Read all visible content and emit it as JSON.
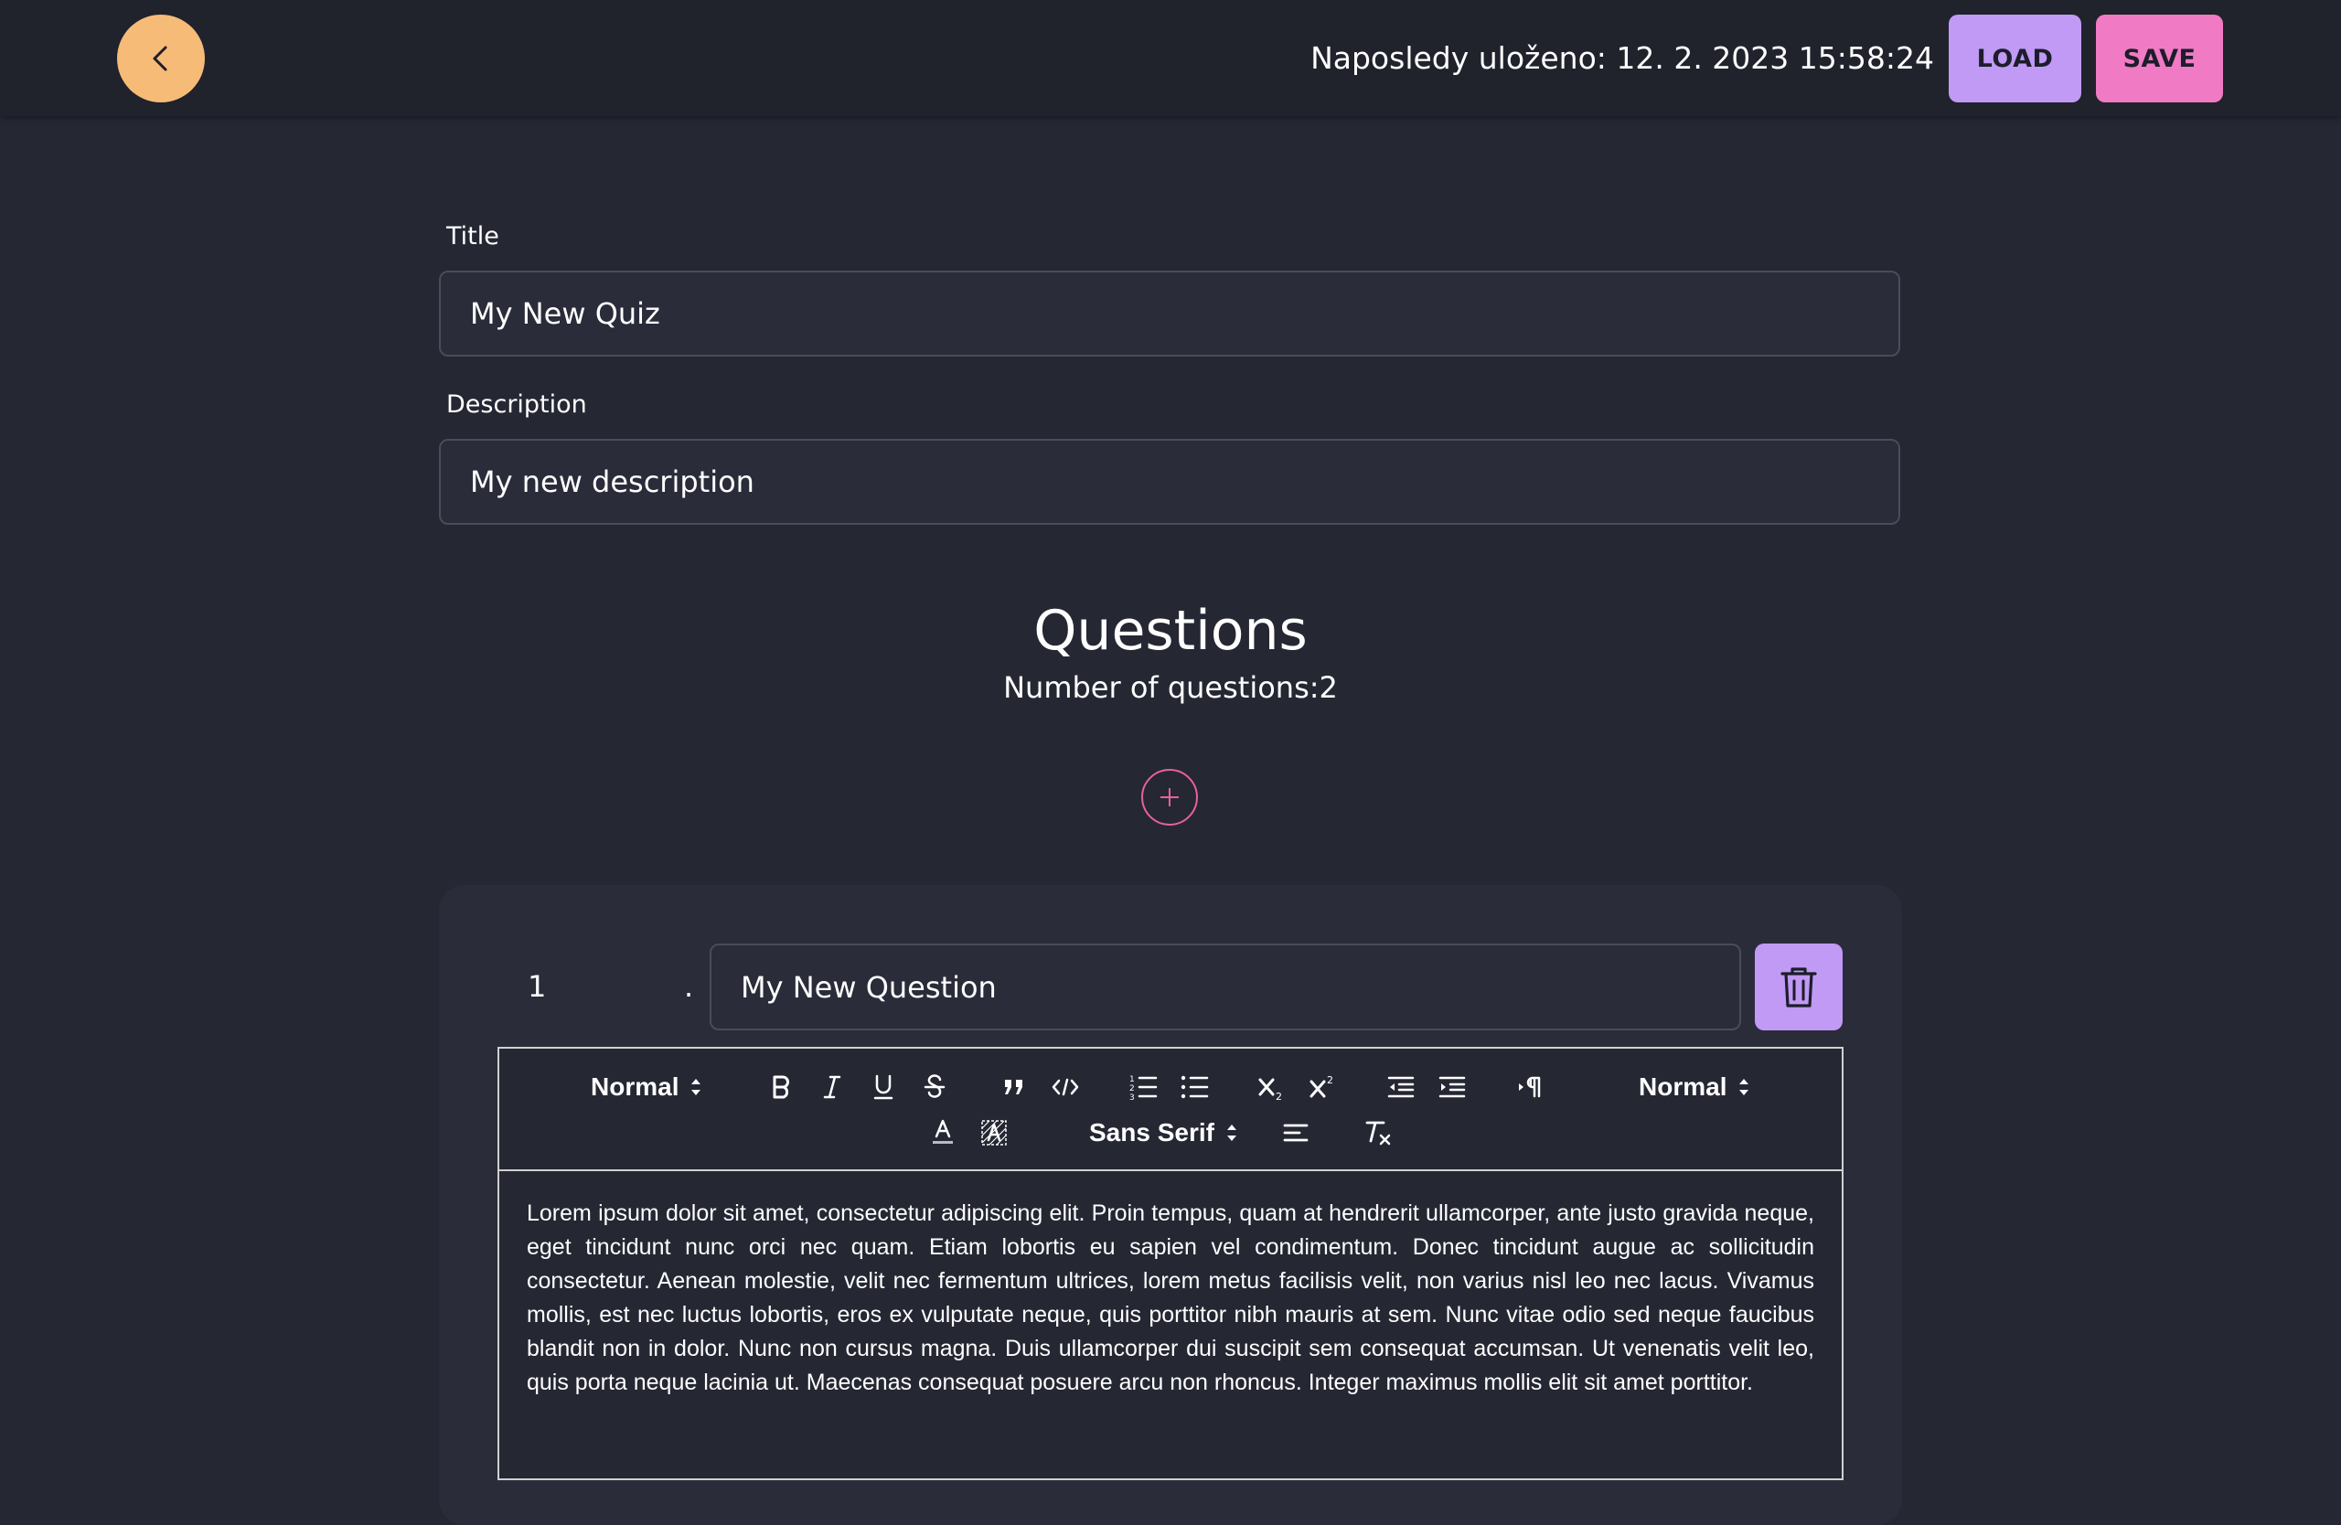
{
  "header": {
    "last_saved": "Naposledy uloženo: 12. 2. 2023 15:58:24",
    "load_label": "LOAD",
    "save_label": "SAVE"
  },
  "form": {
    "title_label": "Title",
    "title_value": "My New Quiz",
    "description_label": "Description",
    "description_value": "My new description"
  },
  "questions": {
    "heading": "Questions",
    "count_text": "Number of questions:2",
    "items": [
      {
        "number": "1",
        "separator": ".",
        "title_value": "My New Question",
        "body": "Lorem ipsum dolor sit amet, consectetur adipiscing elit. Proin tempus, quam at hendrerit ullamcorper, ante justo gravida neque, eget tincidunt nunc orci nec quam. Etiam lobortis eu sapien vel condimentum. Donec tincidunt augue ac sollicitudin consectetur. Aenean molestie, velit nec fermentum ultrices, lorem metus facilisis velit, non varius nisl leo nec lacus. Vivamus mollis, est nec luctus lobortis, eros ex vulputate neque, quis porttitor nibh mauris at sem. Nunc vitae odio sed neque faucibus blandit non in dolor. Nunc non cursus magna. Duis ullamcorper dui suscipit sem consequat accumsan. Ut venenatis velit leo, quis porta neque lacinia ut. Maecenas consequat posuere arcu non rhoncus. Integer maximus mollis elit sit amet porttitor."
      }
    ]
  },
  "toolbar": {
    "header_select": "Normal",
    "size_select": "Normal",
    "font_select": "Sans Serif",
    "buttons": [
      "bold-icon",
      "italic-icon",
      "underline-icon",
      "strike-icon",
      "blockquote-icon",
      "code-block-icon",
      "ordered-list-icon",
      "bullet-list-icon",
      "subscript-icon",
      "superscript-icon",
      "outdent-icon",
      "indent-icon",
      "rtl-direction-icon",
      "text-color-icon",
      "background-color-icon",
      "align-left-icon",
      "clear-format-icon"
    ]
  },
  "colors": {
    "background": "#252733",
    "header": "#20222c",
    "back_button": "#f6bb77",
    "load_button": "#c09af5",
    "save_button": "#f07bc4",
    "add_button_outline": "#e7609f",
    "delete_button": "#c09af5"
  }
}
